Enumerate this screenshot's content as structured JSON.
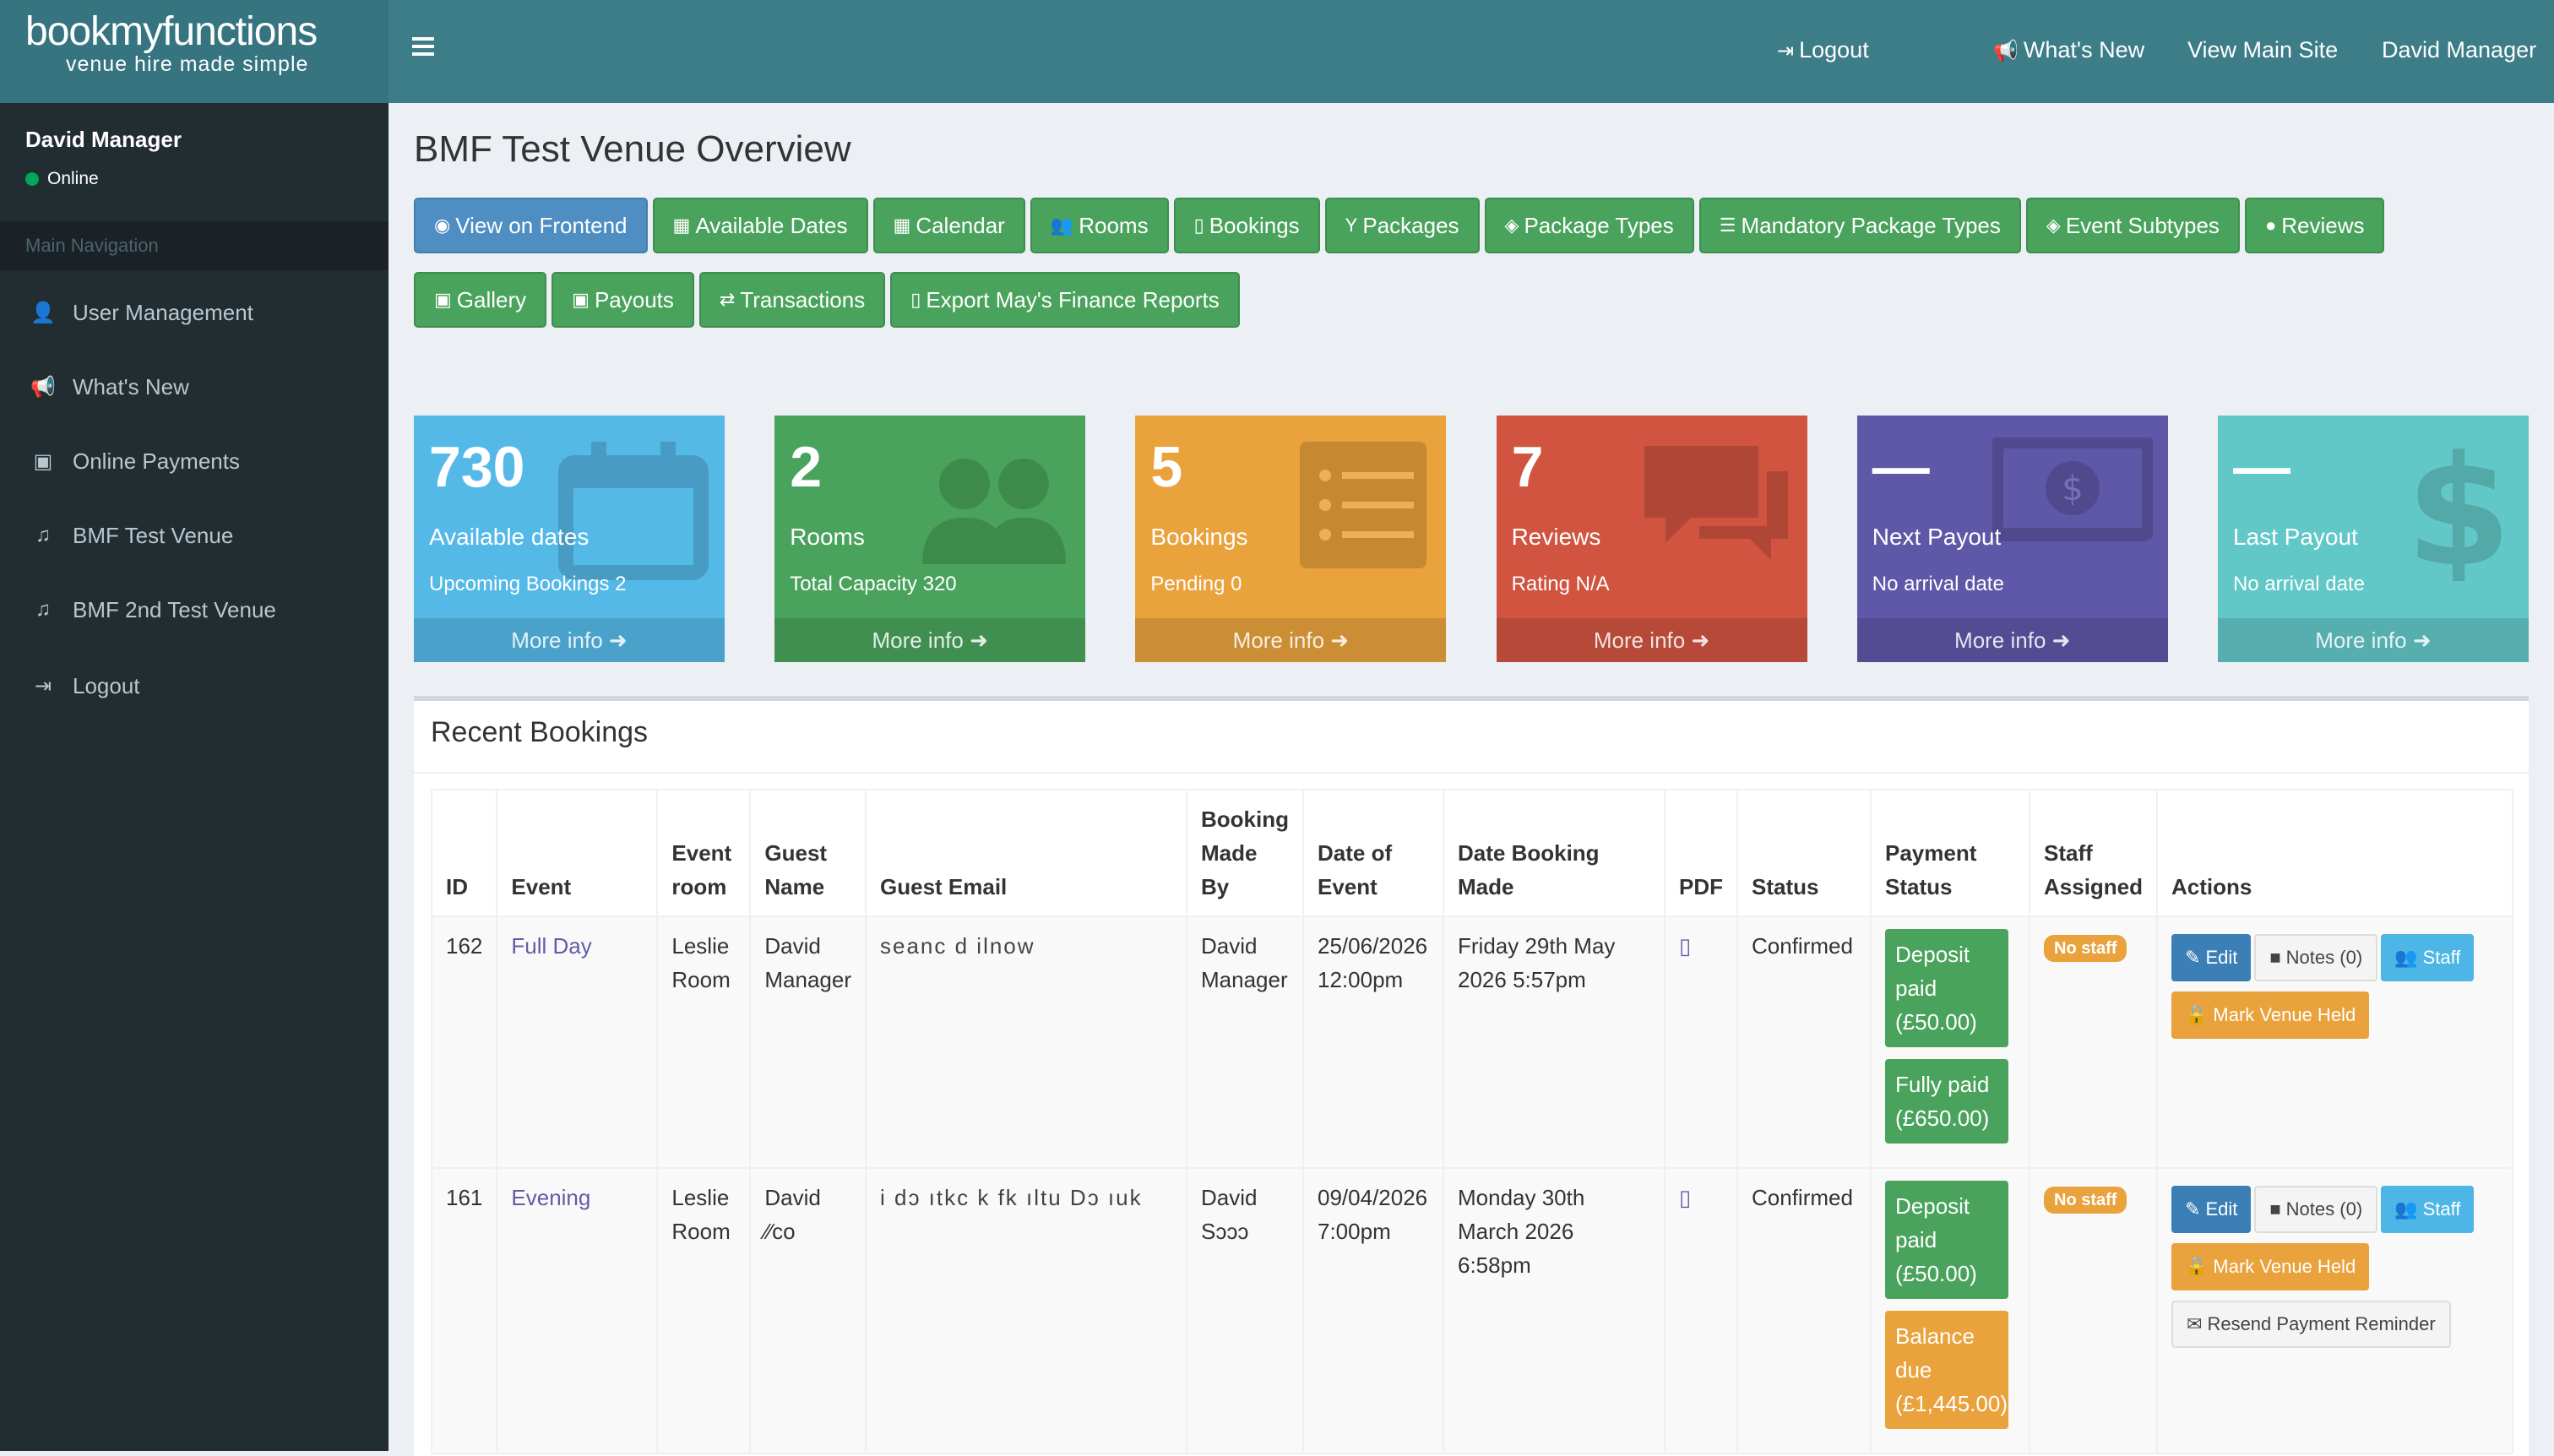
{
  "brand": {
    "name": "bookmyfunctions",
    "tagline": "venue hire made simple"
  },
  "topnav": {
    "logout": "Logout",
    "whats_new": "What's New",
    "view_main_site": "View Main Site",
    "user": "David Manager"
  },
  "sidebar": {
    "user_name": "David Manager",
    "status": "Online",
    "section_header": "Main Navigation",
    "items": [
      {
        "label": "User Management",
        "icon": "user-icon"
      },
      {
        "label": "What's New",
        "icon": "megaphone-icon"
      },
      {
        "label": "Online Payments",
        "icon": "money-icon"
      },
      {
        "label": "BMF Test Venue",
        "icon": "music-icon"
      },
      {
        "label": "BMF 2nd Test Venue",
        "icon": "music-icon"
      },
      {
        "label": "Logout",
        "icon": "logout-icon"
      }
    ]
  },
  "page": {
    "title": "BMF Test Venue Overview"
  },
  "actions": {
    "row1": [
      "View on Frontend",
      "Available Dates",
      "Calendar",
      "Rooms",
      "Bookings",
      "Packages",
      "Package Types",
      "Mandatory Package Types",
      "Event Subtypes",
      "Reviews"
    ],
    "row2": [
      "Gallery",
      "Payouts",
      "Transactions",
      "Export May's Finance Reports"
    ]
  },
  "stats": [
    {
      "value": "730",
      "label": "Available dates",
      "sub": "Upcoming Bookings 2",
      "more": "More info",
      "color": "#55b9e8",
      "icon": "calendar-icon"
    },
    {
      "value": "2",
      "label": "Rooms",
      "sub": "Total Capacity 320",
      "more": "More info",
      "color": "#4aa35c",
      "icon": "users-icon"
    },
    {
      "value": "5",
      "label": "Bookings",
      "sub": "Pending 0",
      "more": "More info",
      "color": "#e9a23c",
      "icon": "list-icon"
    },
    {
      "value": "7",
      "label": "Reviews",
      "sub": "Rating N/A",
      "more": "More info",
      "color": "#d05440",
      "icon": "comments-icon"
    },
    {
      "value": "—",
      "label": "Next Payout",
      "sub": "No arrival date",
      "more": "More info",
      "color": "#5f57a8",
      "icon": "money-icon"
    },
    {
      "value": "—",
      "label": "Last Payout",
      "sub": "No arrival date",
      "more": "More info",
      "color": "#62c7c7",
      "icon": "dollar-icon"
    }
  ],
  "recent": {
    "title": "Recent Bookings",
    "columns": [
      "ID",
      "Event",
      "Event room",
      "Guest Name",
      "Guest Email",
      "Booking Made By",
      "Date of Event",
      "Date Booking Made",
      "PDF",
      "Status",
      "Payment Status",
      "Staff Assigned",
      "Actions"
    ],
    "rows": [
      {
        "id": "162",
        "event": "Full Day",
        "room": "Leslie Room",
        "guest": "David Manager",
        "email": "seanc  d  ilnow",
        "made_by": "David Manager",
        "date_event": "25/06/2026 12:00pm",
        "date_made": "Friday 29th May 2026 5:57pm",
        "status": "Confirmed",
        "payments": [
          "Deposit paid (£50.00)",
          "Fully paid (£650.00)"
        ],
        "staff": "No staff",
        "btn_edit": "Edit",
        "btn_notes": "Notes (0)",
        "btn_staff": "Staff",
        "btn_held": "Mark Venue Held"
      },
      {
        "id": "161",
        "event": "Evening",
        "room": "Leslie Room",
        "guest": "David ∕∕co",
        "email": "i dɔ ıtkc  k  fk  ıltu Dɔ ıuk",
        "made_by": "David Sɔɔɔ",
        "date_event": "09/04/2026 7:00pm",
        "date_made": "Monday 30th March 2026 6:58pm",
        "status": "Confirmed",
        "payments": [
          "Deposit paid (£50.00)",
          "Balance due (£1,445.00)"
        ],
        "staff": "No staff",
        "btn_edit": "Edit",
        "btn_notes": "Notes (0)",
        "btn_staff": "Staff",
        "btn_held": "Mark Venue Held",
        "btn_resend": "Resend Payment Reminder"
      }
    ]
  }
}
